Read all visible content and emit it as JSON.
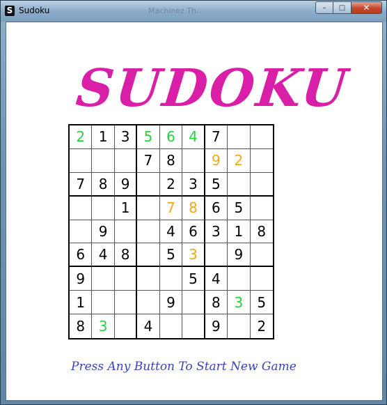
{
  "window": {
    "title": "Sudoku",
    "app_icon_letter": "S",
    "ghost_text": "Machinez Th..",
    "minimize": "–",
    "maximize": "□",
    "close": "✕"
  },
  "logo": "SUDOKU",
  "board": {
    "rows": [
      [
        "2",
        "1",
        "3",
        "5",
        "6",
        "4",
        "7",
        "",
        ""
      ],
      [
        "",
        "",
        "",
        "7",
        "8",
        "",
        "9",
        "2",
        ""
      ],
      [
        "7",
        "8",
        "9",
        "",
        "2",
        "3",
        "5",
        "",
        ""
      ],
      [
        "",
        "",
        "1",
        "",
        "7",
        "8",
        "6",
        "5",
        ""
      ],
      [
        "",
        "9",
        "",
        "",
        "4",
        "6",
        "3",
        "1",
        "8"
      ],
      [
        "6",
        "4",
        "8",
        "",
        "5",
        "3",
        "",
        "9",
        ""
      ],
      [
        "9",
        "",
        "",
        "",
        "",
        "5",
        "4",
        "",
        ""
      ],
      [
        "1",
        "",
        "",
        "",
        "9",
        "",
        "8",
        "3",
        "5"
      ],
      [
        "8",
        "3",
        "",
        "4",
        "",
        "",
        "9",
        "",
        "2"
      ]
    ],
    "colors": [
      [
        "green",
        "black",
        "black",
        "green",
        "green",
        "green",
        "black",
        "",
        ""
      ],
      [
        "",
        "",
        "",
        "black",
        "black",
        "",
        "orange",
        "orange",
        ""
      ],
      [
        "black",
        "black",
        "black",
        "",
        "black",
        "black",
        "black",
        "",
        ""
      ],
      [
        "",
        "",
        "black",
        "",
        "orange",
        "orange",
        "black",
        "black",
        ""
      ],
      [
        "",
        "black",
        "",
        "",
        "black",
        "black",
        "black",
        "black",
        "black"
      ],
      [
        "black",
        "black",
        "black",
        "",
        "black",
        "orange",
        "",
        "black",
        ""
      ],
      [
        "black",
        "",
        "",
        "",
        "",
        "black",
        "black",
        "",
        ""
      ],
      [
        "black",
        "",
        "",
        "",
        "black",
        "",
        "black",
        "green",
        "black"
      ],
      [
        "black",
        "green",
        "",
        "black",
        "",
        "",
        "black",
        "",
        "black"
      ]
    ],
    "palette": {
      "black": "#000000",
      "green": "#22d43a",
      "orange": "#f4a916"
    }
  },
  "prompt": "Press Any Button To Start New Game"
}
